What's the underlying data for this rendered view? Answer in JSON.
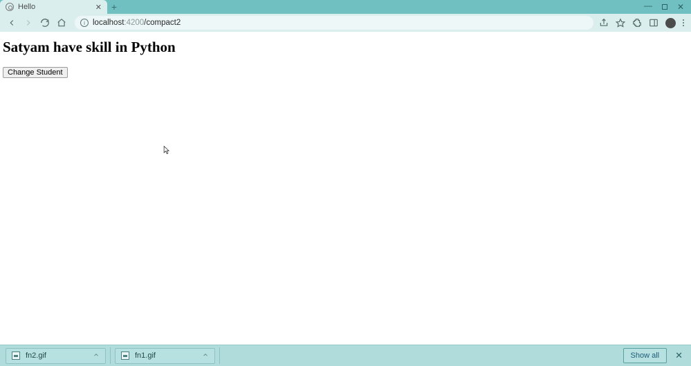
{
  "window": {
    "tab_title": "Hello"
  },
  "address": {
    "host": "localhost",
    "port": ":4200",
    "path": "/compact2"
  },
  "page": {
    "heading": "Satyam have skill in Python",
    "button_label": "Change Student"
  },
  "downloads": {
    "items": [
      {
        "filename": "fn2.gif"
      },
      {
        "filename": "fn1.gif"
      }
    ],
    "show_all_label": "Show all"
  }
}
